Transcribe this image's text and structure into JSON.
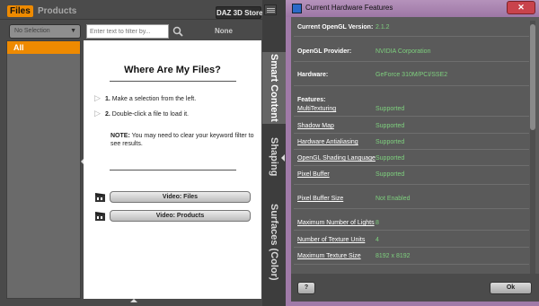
{
  "left_panel": {
    "tabs": {
      "files": "Files",
      "products": "Products"
    },
    "store_button": "DAZ 3D Store",
    "selection_dropdown": "No Selection",
    "filter_placeholder": "Enter text to filter by...",
    "filter_status": "None",
    "list_items": [
      "All"
    ],
    "side_tabs": [
      "Smart Content",
      "Shaping",
      "Surfaces (Color)"
    ],
    "content": {
      "title": "Where Are My Files?",
      "step1_num": "1.",
      "step1_text": "Make a selection from the left.",
      "step2_num": "2.",
      "step2_text": "Double-click a file to load it.",
      "note_label": "NOTE:",
      "note_text": " You may need to clear your keyword filter to see results.",
      "video_files": "Video: Files",
      "video_products": "Video: Products"
    }
  },
  "dialog": {
    "title": "Current Hardware Features",
    "close_label": "✕",
    "version_label": "Current OpenGL Version:",
    "version_value": "2.1.2",
    "provider_label": "OpenGL Provider:",
    "provider_value": "NVIDIA Corporation",
    "hardware_label": "Hardware:",
    "hardware_value": "GeForce 310M/PCI/SSE2",
    "features_label": "Features:",
    "features": [
      {
        "name": "MultiTexturing",
        "value": "Supported"
      },
      {
        "name": "Shadow Map",
        "value": "Supported"
      },
      {
        "name": "Hardware Antialiasing",
        "value": "Supported"
      },
      {
        "name": "OpenGL Shading Language",
        "value": "Supported"
      },
      {
        "name": "Pixel Buffer",
        "value": "Supported"
      },
      {
        "name": "Pixel Buffer Size",
        "value": "Not Enabled"
      },
      {
        "name": "Maximum Number of Lights",
        "value": "8"
      },
      {
        "name": "Number of Texture Units",
        "value": "4"
      },
      {
        "name": "Maximum Texture Size",
        "value": "8192 x 8192"
      }
    ],
    "help_button": "?",
    "ok_button": "Ok"
  },
  "colors": {
    "accent_orange": "#ee8a00",
    "value_green": "#7ed07e",
    "titlebar_purple": "#a07aa8"
  }
}
